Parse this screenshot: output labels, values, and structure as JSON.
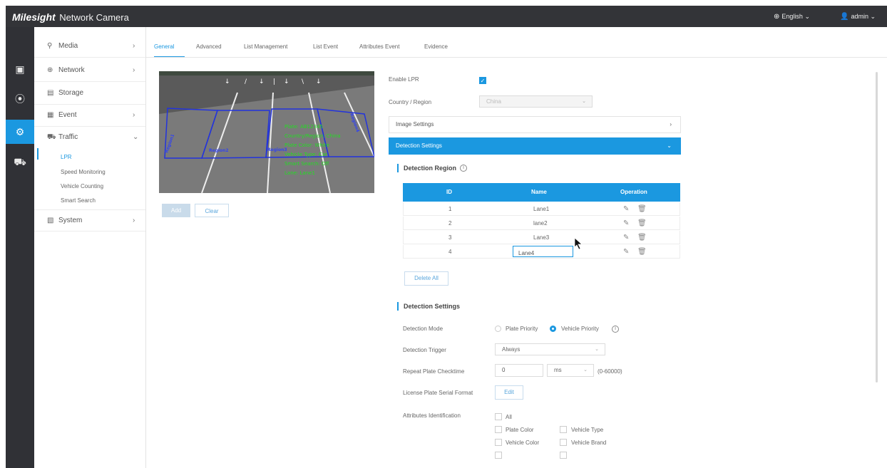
{
  "header": {
    "brand_logo": "Milesight",
    "brand_product": "Network Camera",
    "language": "English",
    "user": "admin"
  },
  "rail": {
    "items": [
      "live-view-icon",
      "playback-icon",
      "settings-icon",
      "vehicle-icon"
    ],
    "active_index": 2
  },
  "sidebar": {
    "items": [
      {
        "label": "Media",
        "icon": "media-icon",
        "expanded": false,
        "has_arrow": true
      },
      {
        "label": "Network",
        "icon": "globe-icon",
        "expanded": false,
        "has_arrow": true
      },
      {
        "label": "Storage",
        "icon": "storage-icon",
        "expanded": false,
        "has_arrow": false
      },
      {
        "label": "Event",
        "icon": "event-icon",
        "expanded": false,
        "has_arrow": true
      },
      {
        "label": "Traffic",
        "icon": "car-icon",
        "expanded": true,
        "has_arrow": true
      },
      {
        "label": "System",
        "icon": "system-icon",
        "expanded": false,
        "has_arrow": true
      }
    ],
    "traffic_sub": [
      "LPR",
      "Speed Monitoring",
      "Vehicle Counting",
      "Smart Search"
    ],
    "active_sub": "LPR"
  },
  "tabs": [
    "General",
    "Advanced",
    "List Management",
    "List Event",
    "Attributes Event",
    "Evidence"
  ],
  "active_tab": "General",
  "video": {
    "region_labels": [
      "Region1",
      "Region2",
      "Region3",
      "Region4"
    ],
    "osd_lines": [
      "Plate: AB12345",
      "Country/Region: China",
      "Plate Color: White",
      "Vehicle Type: Car",
      "Smart Search: Off",
      "Lane: Lane1"
    ],
    "add_label": "Add",
    "clear_label": "Clear"
  },
  "lpr": {
    "enable_label": "Enable LPR",
    "enable_checked": true,
    "country_label": "Country / Region",
    "country_value": "China",
    "image_settings_label": "Image Settings",
    "detection_settings_panel_label": "Detection Settings"
  },
  "detection_region": {
    "title": "Detection Region",
    "columns": [
      "ID",
      "Name",
      "Operation"
    ],
    "rows": [
      {
        "id": "1",
        "name": "Lane1"
      },
      {
        "id": "2",
        "name": "lane2"
      },
      {
        "id": "3",
        "name": "Lane3"
      },
      {
        "id": "4",
        "name": "Lane4"
      }
    ],
    "edit_row_index": 3,
    "edit_icon": "pencil-icon",
    "delete_icon": "trash-icon",
    "delete_all_label": "Delete All"
  },
  "detection_settings": {
    "title": "Detection Settings",
    "mode_label": "Detection Mode",
    "mode_options": [
      "Plate Priority",
      "Vehicle Priority"
    ],
    "mode_selected": "Vehicle Priority",
    "trigger_label": "Detection Trigger",
    "trigger_value": "Always",
    "repeat_label": "Repeat Plate Checktime",
    "repeat_value": "0",
    "repeat_unit": "ms",
    "repeat_range": "(0-60000)",
    "serial_label": "License Plate Serial Format",
    "serial_button": "Edit",
    "attributes_label": "Attributes Identification",
    "attributes": [
      "All",
      "Plate Color",
      "Vehicle Type",
      "Vehicle Color",
      "Vehicle Brand"
    ]
  },
  "colors": {
    "accent": "#1b98e0",
    "header_bg": "#333438",
    "rail_bg": "#303136",
    "region_line": "#2233dd",
    "osd_text": "#22dd22"
  }
}
